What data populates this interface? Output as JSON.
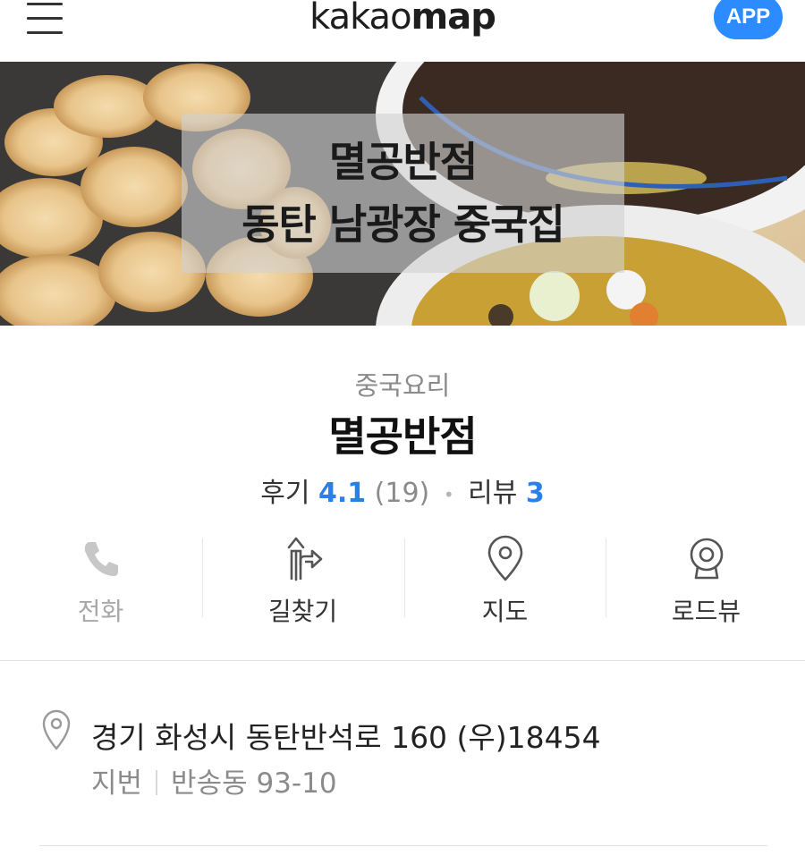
{
  "header": {
    "logo_light": "kakao",
    "logo_bold": "map",
    "app_button": "APP"
  },
  "hero": {
    "line1": "멸공반점",
    "line2": "동탄 남광장 중국집"
  },
  "place": {
    "category": "중국요리",
    "name": "멸공반점",
    "review_label": "후기",
    "review_score": "4.1",
    "review_count": "(19)",
    "blog_label": "리뷰",
    "blog_count": "3"
  },
  "actions": [
    {
      "label": "전화",
      "icon": "phone-icon",
      "enabled": false
    },
    {
      "label": "길찾기",
      "icon": "directions-icon",
      "enabled": true
    },
    {
      "label": "지도",
      "icon": "map-pin-icon",
      "enabled": true
    },
    {
      "label": "로드뷰",
      "icon": "roadview-icon",
      "enabled": true
    }
  ],
  "address": {
    "icon": "location-pin-icon",
    "road": "경기 화성시 동탄반석로 160 (우)18454",
    "jibun_label": "지번",
    "jibun": "반송동 93-10"
  },
  "colors": {
    "accent": "#2b8bff",
    "score_blue": "#2b7fe6",
    "muted": "#8b8b8b"
  }
}
